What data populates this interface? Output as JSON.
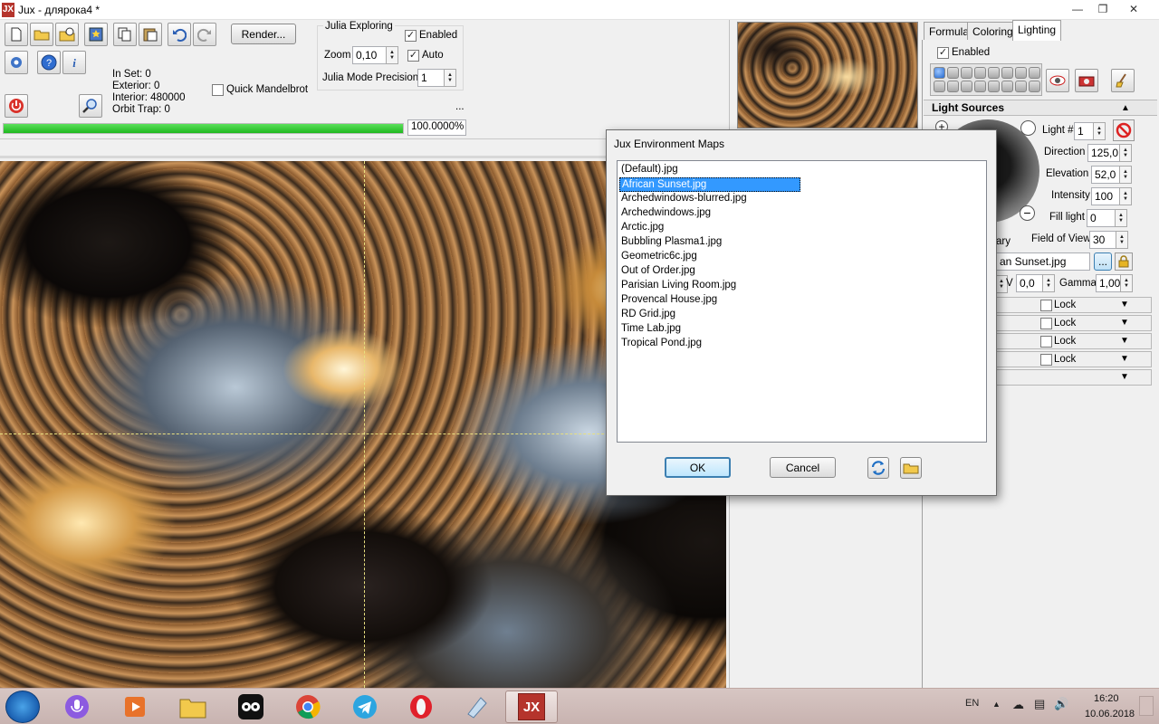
{
  "window": {
    "title": "Jux - длярока4 *",
    "app_icon_text": "JX"
  },
  "toolbar": {
    "render_label": "Render...",
    "in_set": "In Set: 0",
    "exterior": "Exterior: 0",
    "interior": "Interior: 480000",
    "orbit_trap": "Orbit Trap: 0",
    "quick_mandelbrot": "Quick Mandelbrot",
    "progress_value": "100.0000%",
    "progress_fraction": 1.0,
    "ellipsis": "..."
  },
  "julia": {
    "title": "Julia Exploring",
    "enabled_label": "Enabled",
    "enabled": true,
    "zoom_label": "Zoom",
    "zoom_value": "0,10",
    "auto_label": "Auto",
    "auto": true,
    "precision_label": "Julia Mode Precision",
    "precision_value": "1"
  },
  "panel": {
    "tabs": [
      {
        "label": "Formula"
      },
      {
        "label": "Coloring"
      },
      {
        "label": "Lighting",
        "active": true
      }
    ],
    "enabled_label": "Enabled",
    "light_sources_label": "Light Sources",
    "light_num_label": "Light #",
    "light_num_value": "1",
    "direction_label": "Direction",
    "direction_value": "125,0",
    "elevation_label": "Elevation",
    "elevation_value": "52,0",
    "intensity_label": "Intensity",
    "intensity_value": "100",
    "fill_light_label": "Fill light",
    "fill_light_value": "0",
    "ary_label": "ary",
    "fov_label": "Field of View",
    "fov_value": "30",
    "env_file": "an Sunset.jpg",
    "browse_label": "...",
    "v_label": "V",
    "v_value": "0,0",
    "gamma_label": "Gamma",
    "gamma_value": "1,00",
    "lock_label": "Lock"
  },
  "dialog": {
    "title": "Jux Environment Maps",
    "items": [
      "(Default).jpg",
      "African Sunset.jpg",
      "Archedwindows-blurred.jpg",
      "Archedwindows.jpg",
      "Arctic.jpg",
      "Bubbling Plasma1.jpg",
      "Geometric6c.jpg",
      "Out of Order.jpg",
      "Parisian Living Room.jpg",
      "Provencal House.jpg",
      "RD Grid.jpg",
      "Time Lab.jpg",
      "Tropical Pond.jpg"
    ],
    "selected_index": 1,
    "ok_label": "OK",
    "cancel_label": "Cancel"
  },
  "taskbar": {
    "lang": "EN",
    "time": "16:20",
    "date": "10.06.2018",
    "jux_label": "JX"
  },
  "colors": {
    "accent": "#3399ff",
    "progress": "#22c322",
    "title_icon": "#b5342c"
  }
}
